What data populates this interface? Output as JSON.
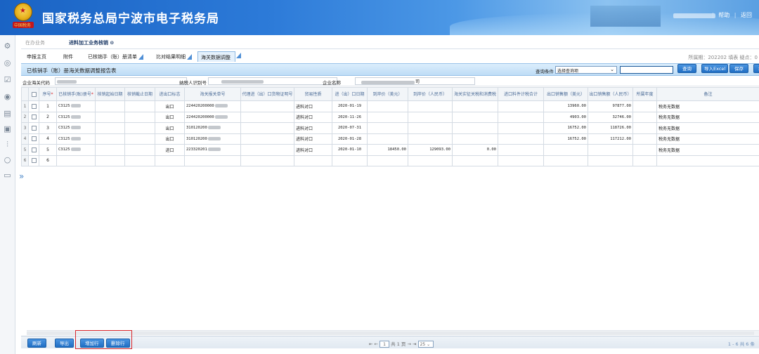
{
  "header": {
    "title": "国家税务总局宁波市电子税务局",
    "emblem_ribbon": "中国税务",
    "links": [
      "帮助",
      "返回"
    ]
  },
  "subnav": {
    "items": [
      {
        "label": "在办业务",
        "active": false
      },
      {
        "label": "进料加工业务核销 ⊙",
        "active": true
      }
    ]
  },
  "tabs": {
    "items": [
      "申报主页",
      "附件",
      "已核销手（账）册清单",
      "比对结果明细",
      "海关数据调整"
    ],
    "active_index": 4,
    "right_prefix": "所属期：",
    "period": "202202",
    "right_suffix": "填表  疑点：0"
  },
  "toolbar": {
    "title": "已核销手（账）册海关数据调整报告表",
    "query_label": "查询条件",
    "query_select_value": "选择查询项",
    "buttons": [
      "查询",
      "导入Excel",
      "保存",
      "打印"
    ]
  },
  "info": {
    "customs_code_label": "企业海关代码",
    "taxpayer_id_label": "纳税人识别号",
    "company_name_label": "企业名称",
    "company_name_suffix": "司"
  },
  "table": {
    "columns": [
      "",
      "",
      "序号",
      "已核销手(账)册号",
      "核销起始日期",
      "核销截止日期",
      "进出口标志",
      "海关报关单号",
      "代理进（出）口货物证明号",
      "贸易性质",
      "进（出）口日期",
      "到岸价（美元）",
      "到岸价（人民币）",
      "海关实征关税和消费税",
      "进口料件计税合计",
      "出口销售额（美元）",
      "出口销售额（人民币）",
      "所属年度",
      "备注"
    ],
    "rows": [
      {
        "rownum": "1",
        "seq": "1",
        "handbook": "C3125",
        "flag": "出口",
        "decl": "224420200000",
        "trade": "进料对口",
        "date": "2020-01-19",
        "cif_usd": "",
        "cif_rmb": "",
        "duty": "",
        "exp_usd": "13960.00",
        "exp_rmb": "97877.00",
        "remark": "税务无数据"
      },
      {
        "rownum": "2",
        "seq": "2",
        "handbook": "C3125",
        "flag": "出口",
        "decl": "224420200000",
        "trade": "进料对口",
        "date": "2020-11-26",
        "cif_usd": "",
        "cif_rmb": "",
        "duty": "",
        "exp_usd": "4903.00",
        "exp_rmb": "32746.00",
        "remark": "税务无数据"
      },
      {
        "rownum": "3",
        "seq": "3",
        "handbook": "C3125",
        "flag": "出口",
        "decl": "310120200",
        "trade": "进料对口",
        "date": "2020-07-31",
        "cif_usd": "",
        "cif_rmb": "",
        "duty": "",
        "exp_usd": "16752.00",
        "exp_rmb": "118726.00",
        "remark": "税务无数据"
      },
      {
        "rownum": "4",
        "seq": "4",
        "handbook": "C3125",
        "flag": "出口",
        "decl": "310120200",
        "trade": "进料对口",
        "date": "2020-01-28",
        "cif_usd": "",
        "cif_rmb": "",
        "duty": "",
        "exp_usd": "16752.00",
        "exp_rmb": "117212.00",
        "remark": "税务无数据"
      },
      {
        "rownum": "5",
        "seq": "5",
        "handbook": "C3125",
        "flag": "进口",
        "decl": "223320201",
        "trade": "进料对口",
        "date": "2020-01-10",
        "cif_usd": "18450.00",
        "cif_rmb": "129093.00",
        "duty": "0.00",
        "exp_usd": "",
        "exp_rmb": "",
        "remark": "税务无数据"
      },
      {
        "rownum": "6",
        "seq": "6",
        "handbook": "",
        "flag": "",
        "decl": "",
        "trade": "",
        "date": "",
        "cif_usd": "",
        "cif_rmb": "",
        "duty": "",
        "exp_usd": "",
        "exp_rmb": "",
        "remark": ""
      }
    ]
  },
  "footer": {
    "buttons": [
      "刷新",
      "导出",
      "增加行",
      "删除行"
    ],
    "pager_page": "1",
    "pager_total_text": "共 1 页",
    "page_size": "25",
    "count_text": "1 - 6  共 6 条"
  }
}
